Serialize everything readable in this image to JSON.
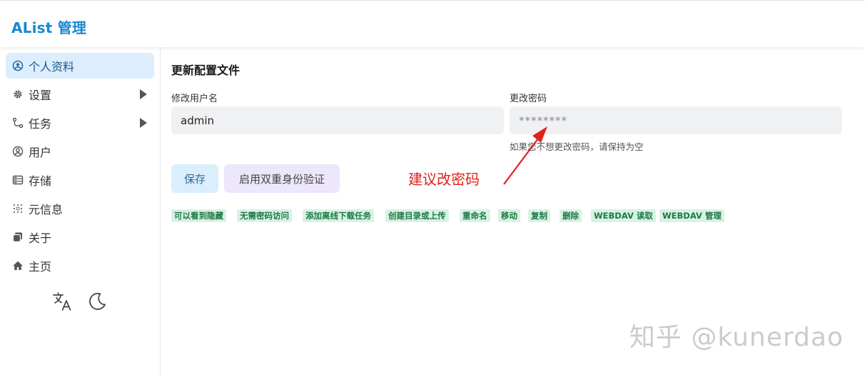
{
  "app": {
    "title": "AList 管理"
  },
  "sidebar": {
    "items": [
      {
        "label": "个人资料",
        "icon": "profile-icon",
        "active": true,
        "expandable": false
      },
      {
        "label": "设置",
        "icon": "gear-icon",
        "active": false,
        "expandable": true
      },
      {
        "label": "任务",
        "icon": "tasks-icon",
        "active": false,
        "expandable": true
      },
      {
        "label": "用户",
        "icon": "user-icon",
        "active": false,
        "expandable": false
      },
      {
        "label": "存储",
        "icon": "storage-icon",
        "active": false,
        "expandable": false
      },
      {
        "label": "元信息",
        "icon": "meta-icon",
        "active": false,
        "expandable": false
      },
      {
        "label": "关于",
        "icon": "about-icon",
        "active": false,
        "expandable": false
      },
      {
        "label": "主页",
        "icon": "home-icon",
        "active": false,
        "expandable": false
      }
    ],
    "tools": [
      {
        "icon": "translate-icon"
      },
      {
        "icon": "moon-icon"
      }
    ]
  },
  "main": {
    "section_title": "更新配置文件",
    "username": {
      "label": "修改用户名",
      "value": "admin"
    },
    "password": {
      "label": "更改密码",
      "placeholder": "********",
      "hint": "如果您不想更改密码，请保持为空"
    },
    "buttons": {
      "save": "保存",
      "enable_2fa": "启用双重身份验证"
    },
    "permissions": [
      "可以看到隐藏",
      "无需密码访问",
      "添加离线下载任务",
      "创建目录或上传",
      "重命名",
      "移动",
      "复制",
      "删除",
      "WEBDAV 读取",
      "WEBDAV 管理"
    ]
  },
  "annotation": {
    "text": "建议改密码",
    "color": "#e0221a"
  },
  "watermark": {
    "text": "知乎 @kunerdao"
  },
  "colors": {
    "brand": "#1a87d0",
    "active_bg": "#dceefd",
    "perm_bg": "#d9f2e3",
    "perm_text": "#1b7a44"
  }
}
